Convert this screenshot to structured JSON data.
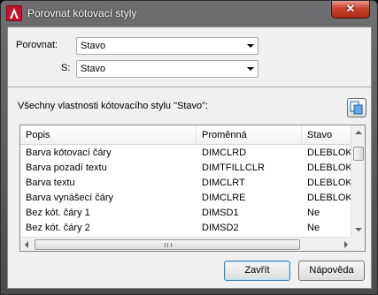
{
  "window": {
    "title": "Porovnat kótovací styly",
    "close_label": "✕"
  },
  "compare": {
    "label": "Porovnat:",
    "value": "Stavo"
  },
  "with": {
    "label": "S:",
    "value": "Stavo"
  },
  "properties_label": "Všechny vlastnosti kótovacího stylu \"Stavo\":",
  "grid": {
    "columns": [
      "Popis",
      "Proměnná",
      "Stavo"
    ],
    "rows": [
      [
        "Barva kótovací čáry",
        "DIMCLRD",
        "DLEBLOKU"
      ],
      [
        "Barva pozadí textu",
        "DIMTFILLCLR",
        "DLEBLOKU"
      ],
      [
        "Barva textu",
        "DIMCLRT",
        "DLEBLOKU"
      ],
      [
        "Barva vynášecí čáry",
        "DIMCLRE",
        "DLEBLOKU"
      ],
      [
        "Bez kót. čáry 1",
        "DIMSD1",
        "Ne"
      ],
      [
        "Bez kót. čáry 2",
        "DIMSD2",
        "Ne"
      ]
    ]
  },
  "buttons": {
    "close": "Zavřít",
    "help": "Nápověda"
  },
  "icons": {
    "app": "autocad-icon",
    "copy": "copy-to-clipboard-icon"
  },
  "colors": {
    "app_icon": "#c8102e",
    "close_button": "#c7432e"
  }
}
